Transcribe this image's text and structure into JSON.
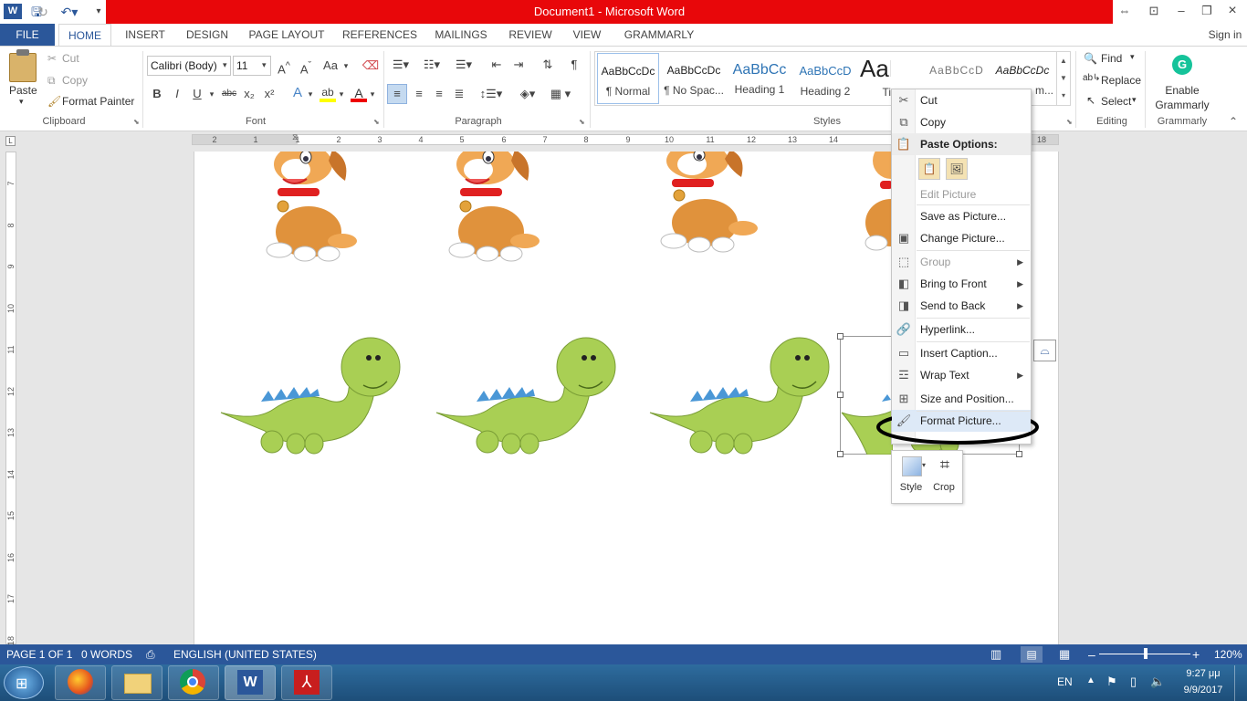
{
  "app": {
    "title": "Document1 - Microsoft Word",
    "signin": "Sign in"
  },
  "tabs": [
    "FILE",
    "HOME",
    "INSERT",
    "DESIGN",
    "PAGE LAYOUT",
    "REFERENCES",
    "MAILINGS",
    "REVIEW",
    "VIEW",
    "GRAMMARLY"
  ],
  "clipboard": {
    "paste": "Paste",
    "cut": "Cut",
    "copy": "Copy",
    "format_painter": "Format Painter",
    "group": "Clipboard"
  },
  "font": {
    "family": "Calibri (Body)",
    "size": "11",
    "group": "Font",
    "aa": "Aa",
    "bold": "B",
    "italic": "I",
    "underline": "U",
    "strike": "abc",
    "sub": "x₂",
    "sup": "x²"
  },
  "paragraph": {
    "group": "Paragraph"
  },
  "styles": {
    "group": "Styles",
    "items": [
      {
        "sample": "AaBbCcDc",
        "name": "¶ Normal"
      },
      {
        "sample": "AaBbCcDc",
        "name": "¶ No Spac..."
      },
      {
        "sample": "AaBbCc",
        "name": "Heading 1"
      },
      {
        "sample": "AaBbCcD",
        "name": "Heading 2"
      },
      {
        "sample": "AaBl",
        "name": "Ti"
      },
      {
        "sample": "AaBbCcD",
        "name": ""
      },
      {
        "sample": "AaBbCcDc",
        "name": "m..."
      }
    ]
  },
  "editing": {
    "find": "Find",
    "replace": "Replace",
    "select": "Select",
    "group": "Editing"
  },
  "grammarly": {
    "enable": "Enable",
    "name": "Grammarly",
    "group": "Grammarly"
  },
  "ruler": {
    "h": [
      "2",
      "1",
      "1",
      "2",
      "3",
      "4",
      "5",
      "6",
      "7",
      "8",
      "9",
      "10",
      "11",
      "12",
      "13",
      "14",
      "18"
    ],
    "v": [
      "7",
      "8",
      "9",
      "10",
      "11",
      "12",
      "13",
      "14",
      "15",
      "16",
      "17",
      "18"
    ]
  },
  "context_menu": {
    "items": [
      {
        "label": "Cut",
        "icon": "scissors-icon",
        "disabled": false
      },
      {
        "label": "Copy",
        "icon": "copy-icon",
        "disabled": false
      },
      {
        "label": "Paste Options:",
        "icon": "clipboard-icon",
        "disabled": false
      },
      {
        "label": "Edit Picture",
        "icon": "",
        "disabled": true
      },
      {
        "label": "Save as Picture...",
        "icon": "",
        "disabled": false
      },
      {
        "label": "Change Picture...",
        "icon": "change-picture-icon",
        "disabled": false
      },
      {
        "label": "Group",
        "icon": "group-icon",
        "disabled": true
      },
      {
        "label": "Bring to Front",
        "icon": "bring-front-icon",
        "disabled": false
      },
      {
        "label": "Send to Back",
        "icon": "send-back-icon",
        "disabled": false
      },
      {
        "label": "Hyperlink...",
        "icon": "hyperlink-icon",
        "disabled": false
      },
      {
        "label": "Insert Caption...",
        "icon": "caption-icon",
        "disabled": false
      },
      {
        "label": "Wrap Text",
        "icon": "wrap-text-icon",
        "disabled": false
      },
      {
        "label": "Size and Position...",
        "icon": "size-position-icon",
        "disabled": false
      },
      {
        "label": "Format Picture...",
        "icon": "format-picture-icon",
        "disabled": false
      }
    ]
  },
  "minibar": {
    "style": "Style",
    "crop": "Crop"
  },
  "status": {
    "page": "PAGE 1 OF 1",
    "words": "0 WORDS",
    "language": "ENGLISH (UNITED STATES)",
    "zoom": "120%"
  },
  "taskbar": {
    "lang": "EN",
    "time": "9:27 μμ",
    "date": "9/9/2017"
  }
}
